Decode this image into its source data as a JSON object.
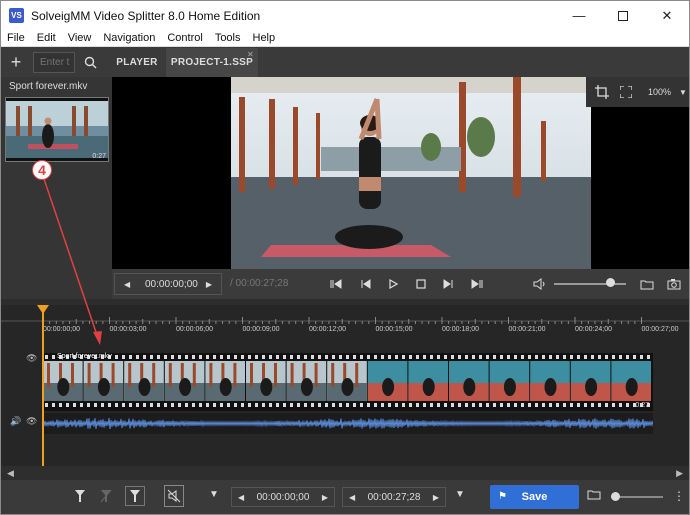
{
  "window": {
    "title": "SolveigMM Video Splitter 8.0 Home Edition",
    "icon_text": "VS"
  },
  "menu": [
    "File",
    "Edit",
    "View",
    "Navigation",
    "Control",
    "Tools",
    "Help"
  ],
  "toolbar": {
    "search_placeholder": "Enter t",
    "tabs": [
      "PLAYER",
      "PROJECT-1.SSP"
    ]
  },
  "media_panel": {
    "clip_name": "Sport forever.mkv",
    "thumb_time": "0:27"
  },
  "player": {
    "zoom": "100%",
    "timecode": "00:00:00;00",
    "duration": "/ 00:00:27;28"
  },
  "timeline": {
    "ticks": [
      "00:00:00;00",
      "00:00:03;00",
      "00:00:06;00",
      "00:00:09;00",
      "00:00:12;00",
      "00:00:15;00",
      "00:00:18;00",
      "00:00:21;00",
      "00:00:24;00",
      "00:00:27;00"
    ],
    "track_label": "Sport forever.mkv",
    "track_end_time": "0:27"
  },
  "bottom": {
    "start_time": "00:00:00;00",
    "end_time": "00:00:27;28",
    "save_label": "Save"
  },
  "annotation": {
    "number": "4",
    "color": "#e24040"
  },
  "colors": {
    "accent": "#2f6fd6",
    "playhead": "#f0a020",
    "waveform": "#5a8ad8"
  }
}
